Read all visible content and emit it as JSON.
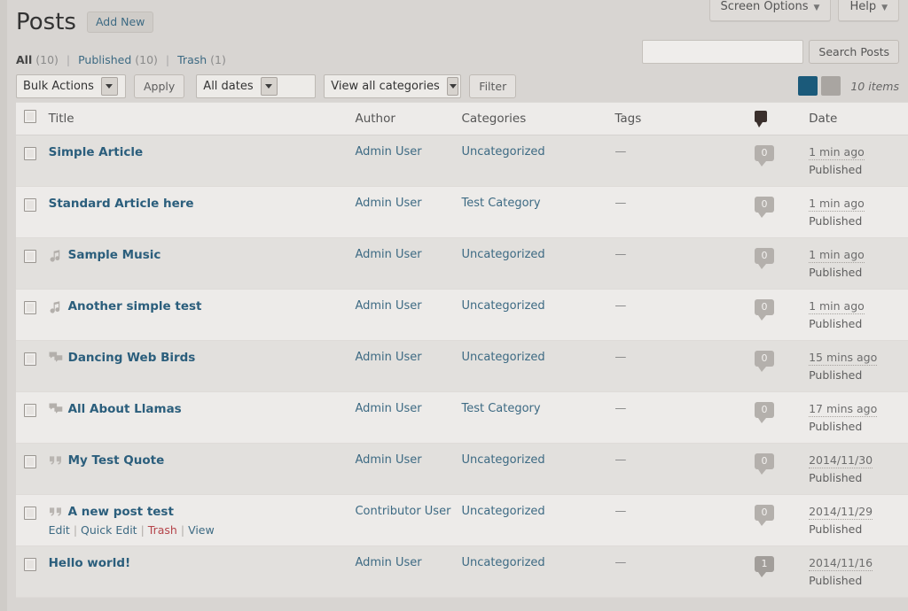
{
  "screen_meta": {
    "screen_options_label": "Screen Options",
    "help_label": "Help",
    "caret_glyph": "▼"
  },
  "header": {
    "page_title": "Posts",
    "add_new_label": "Add New"
  },
  "status_links": {
    "separator": "|",
    "items": [
      {
        "label": "All",
        "count": "(10)",
        "current": true
      },
      {
        "label": "Published",
        "count": "(10)",
        "current": false
      },
      {
        "label": "Trash",
        "count": "(1)",
        "current": false
      }
    ]
  },
  "search": {
    "value": "",
    "placeholder": "",
    "submit_label": "Search Posts"
  },
  "tablenav": {
    "bulk_actions_selected": "Bulk Actions",
    "apply_label": "Apply",
    "dates_selected": "All dates",
    "categories_selected": "View all categories",
    "filter_label": "Filter"
  },
  "view_switch": {
    "list_view_name": "list-view",
    "excerpt_view_name": "excerpt-view",
    "active": "list-view",
    "items_count": "10 items"
  },
  "table": {
    "columns": {
      "cb": "",
      "title": "Title",
      "author": "Author",
      "categories": "Categories",
      "tags": "Tags",
      "comments": "",
      "date": "Date"
    },
    "rows": [
      {
        "title": "Simple Article",
        "format_icon": "",
        "author": "Admin User",
        "categories": "Uncategorized",
        "tags": "—",
        "comments": "0",
        "date": "1 min ago",
        "status": "Published",
        "actions_visible": false
      },
      {
        "title": "Standard Article here",
        "format_icon": "",
        "author": "Admin User",
        "categories": "Test Category",
        "tags": "—",
        "comments": "0",
        "date": "1 min ago",
        "status": "Published",
        "actions_visible": false
      },
      {
        "title": "Sample Music",
        "format_icon": "audio-icon",
        "author": "Admin User",
        "categories": "Uncategorized",
        "tags": "—",
        "comments": "0",
        "date": "1 min ago",
        "status": "Published",
        "actions_visible": false
      },
      {
        "title": "Another simple test",
        "format_icon": "audio-icon",
        "author": "Admin User",
        "categories": "Uncategorized",
        "tags": "—",
        "comments": "0",
        "date": "1 min ago",
        "status": "Published",
        "actions_visible": false
      },
      {
        "title": "Dancing Web Birds",
        "format_icon": "aside-icon",
        "author": "Admin User",
        "categories": "Uncategorized",
        "tags": "—",
        "comments": "0",
        "date": "15 mins ago",
        "status": "Published",
        "actions_visible": false
      },
      {
        "title": "All About Llamas",
        "format_icon": "aside-icon",
        "author": "Admin User",
        "categories": "Test Category",
        "tags": "—",
        "comments": "0",
        "date": "17 mins ago",
        "status": "Published",
        "actions_visible": false
      },
      {
        "title": "My Test Quote",
        "format_icon": "quote-icon",
        "author": "Admin User",
        "categories": "Uncategorized",
        "tags": "—",
        "comments": "0",
        "date": "2014/11/30",
        "status": "Published",
        "actions_visible": false
      },
      {
        "title": "A new post test",
        "format_icon": "quote-icon",
        "author": "Contributor User",
        "categories": "Uncategorized",
        "tags": "—",
        "comments": "0",
        "date": "2014/11/29",
        "status": "Published",
        "actions_visible": true,
        "actions": {
          "edit": "Edit",
          "quick_edit": "Quick Edit",
          "trash": "Trash",
          "view": "View",
          "separator": "|"
        }
      },
      {
        "title": "Hello world!",
        "format_icon": "",
        "author": "Admin User",
        "categories": "Uncategorized",
        "tags": "—",
        "comments": "1",
        "date": "2014/11/16",
        "status": "Published",
        "actions_visible": false
      }
    ]
  },
  "colors": {
    "page_background": "#d8d5d2",
    "row_alt": "#e2e0dd",
    "row_norm": "#edebe9",
    "link": "#3d6a83",
    "post_link": "#2b5e7c",
    "trash_link": "#b5444a",
    "view_switch_active": "#1b5a7a"
  }
}
